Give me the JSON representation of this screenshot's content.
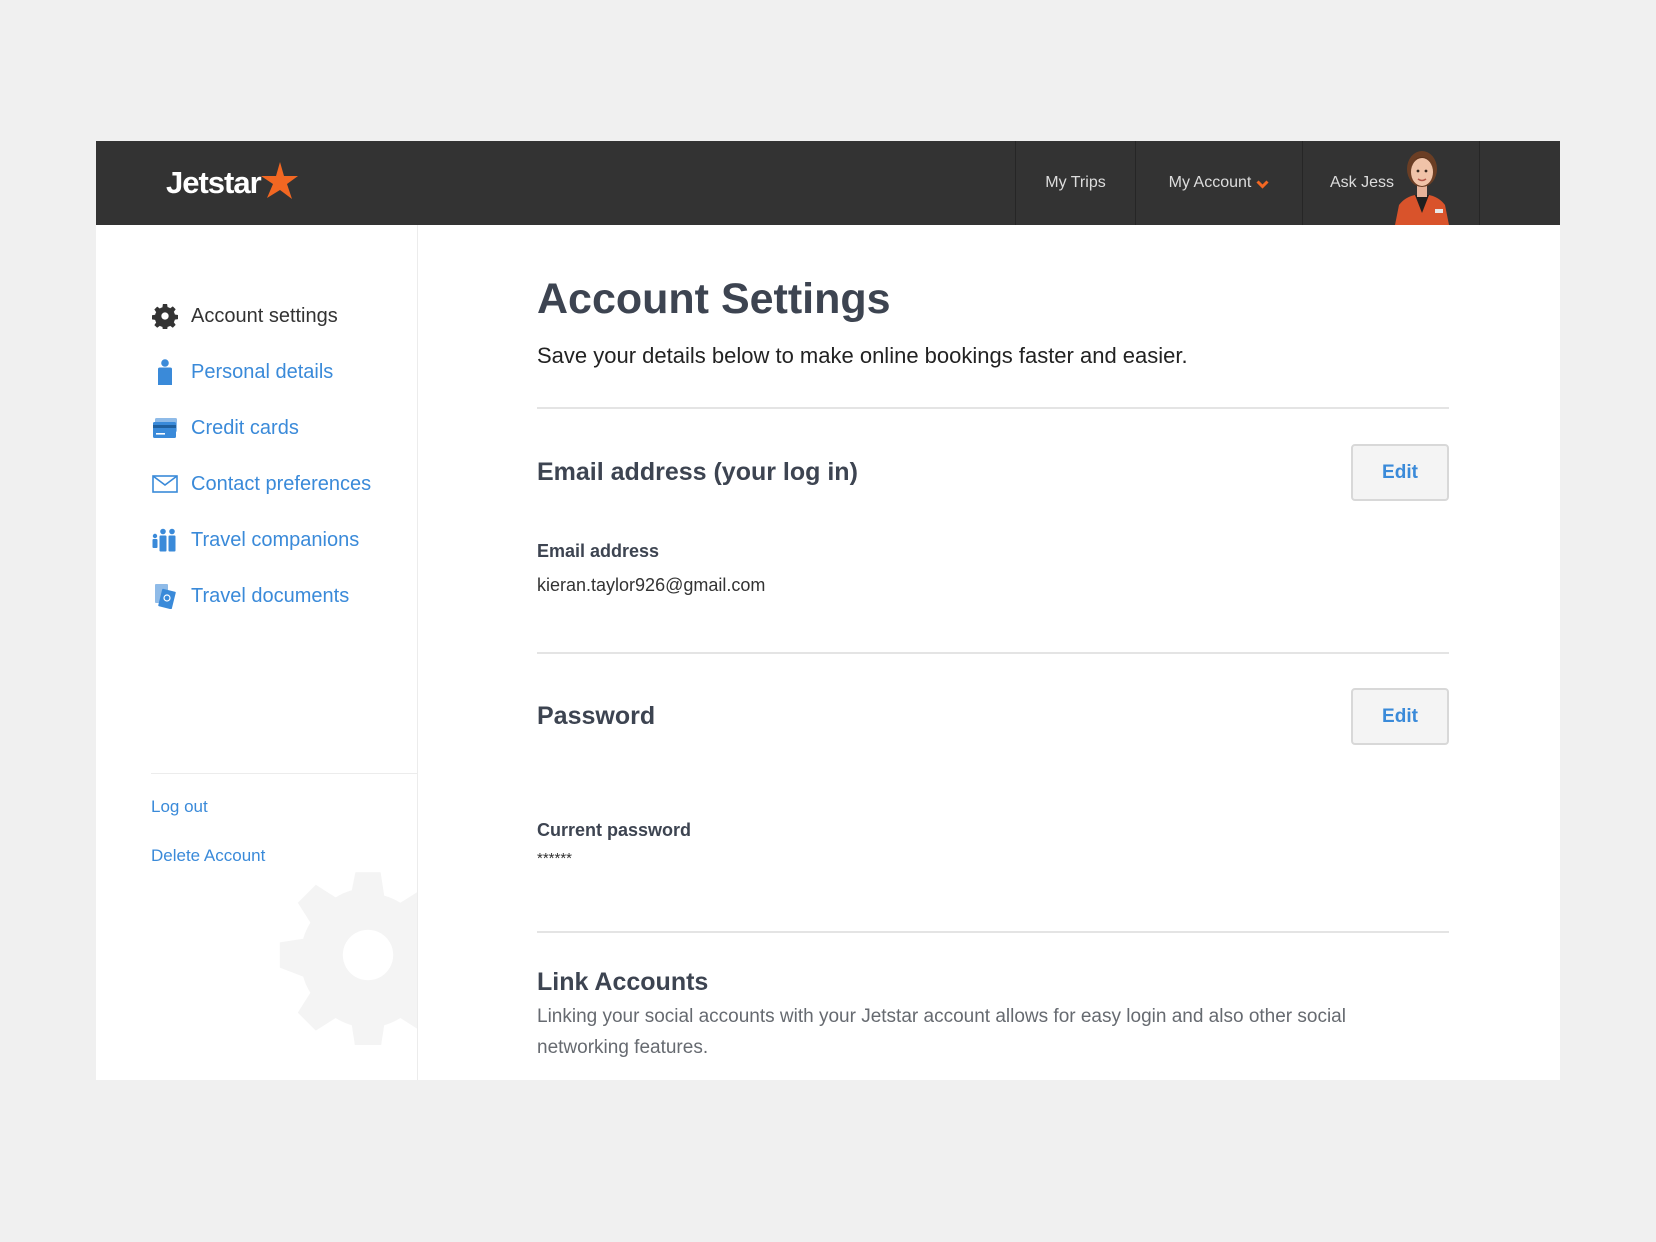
{
  "header": {
    "logo_text": "Jetstar",
    "nav": {
      "my_trips": "My Trips",
      "my_account": "My Account",
      "ask_jess": "Ask Jess"
    }
  },
  "sidebar": {
    "items": [
      {
        "label": "Account settings",
        "icon": "gear-icon",
        "active": true
      },
      {
        "label": "Personal details",
        "icon": "person-icon"
      },
      {
        "label": "Credit cards",
        "icon": "credit-card-icon"
      },
      {
        "label": "Contact preferences",
        "icon": "envelope-icon"
      },
      {
        "label": "Travel companions",
        "icon": "people-icon"
      },
      {
        "label": "Travel documents",
        "icon": "passport-icon"
      }
    ],
    "log_out": "Log out",
    "delete_account": "Delete Account"
  },
  "main": {
    "title": "Account Settings",
    "subtitle": "Save your details below to make online bookings faster and easier.",
    "email_section": {
      "title": "Email address (your log in)",
      "edit_label": "Edit",
      "field_label": "Email address",
      "field_value": "kieran.taylor926@gmail.com"
    },
    "password_section": {
      "title": "Password",
      "edit_label": "Edit",
      "field_label": "Current password",
      "field_value": "******"
    },
    "link_accounts": {
      "title": "Link Accounts",
      "description": "Linking your social accounts with your Jetstar account allows for easy login and also other social networking features."
    }
  },
  "colors": {
    "header_bg": "#333333",
    "accent_orange": "#f26722",
    "link_blue": "#3a8ad9",
    "heading": "#3d4451"
  }
}
